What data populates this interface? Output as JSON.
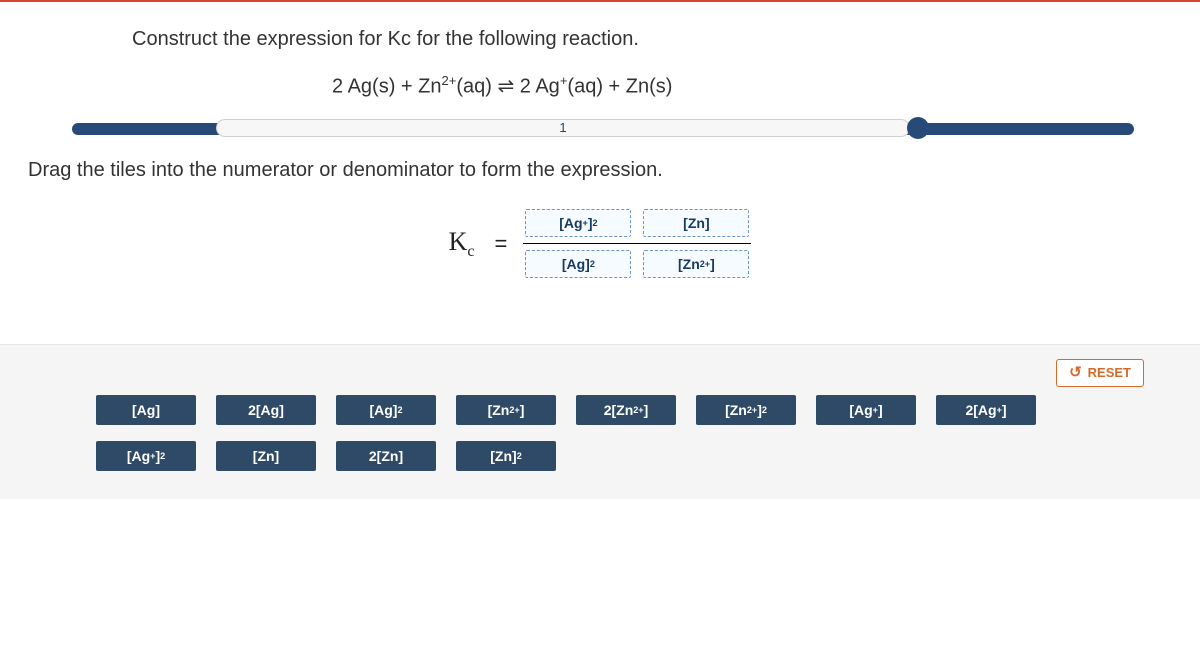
{
  "prompt": "Construct the expression for Kc for the following reaction.",
  "equation_html": "2 Ag(s) + Zn<sup>2+</sup>(aq) ⇌ 2 Ag<sup>+</sup>(aq) + Zn(s)",
  "progress": {
    "label": "1"
  },
  "drag_instruction": "Drag the tiles into the numerator or denominator to form the expression.",
  "expr": {
    "kc_html": "K<sub>c</sub>",
    "equals": "=",
    "numerator": [
      {
        "html": "[Ag<sup>+</sup>]<sup>2</sup>"
      },
      {
        "html": "[Zn]"
      }
    ],
    "denominator": [
      {
        "html": "[Ag]<sup>2</sup>"
      },
      {
        "html": "[Zn<sup>2+</sup>]"
      }
    ]
  },
  "reset_label": "RESET",
  "tiles_row1": [
    {
      "html": "[Ag]"
    },
    {
      "html": "2[Ag]"
    },
    {
      "html": "[Ag]<sup>2</sup>"
    },
    {
      "html": "[Zn<sup>2+</sup>]"
    },
    {
      "html": "2[Zn<sup>2+</sup>]"
    },
    {
      "html": "[Zn<sup>2+</sup>]<sup>2</sup>"
    },
    {
      "html": "[Ag<sup>+</sup>]"
    },
    {
      "html": "2[Ag<sup>+</sup>]"
    }
  ],
  "tiles_row2": [
    {
      "html": "[Ag<sup>+</sup>]<sup>2</sup>"
    },
    {
      "html": "[Zn]"
    },
    {
      "html": "2[Zn]"
    },
    {
      "html": "[Zn]<sup>2</sup>"
    }
  ]
}
